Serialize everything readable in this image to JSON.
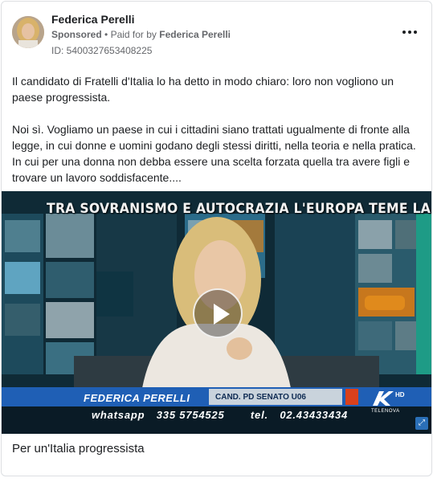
{
  "ad": {
    "page_name": "Federica Perelli",
    "sponsored_label": "Sponsored",
    "separator": "•",
    "paid_for_prefix": "Paid for by",
    "paid_for_name": "Federica Perelli",
    "ad_id": "ID: 5400327653408225",
    "more_icon": "more-horizontal-icon",
    "body_paragraphs": [
      "Il candidato di Fratelli d'Italia lo ha detto in modo chiaro: loro non vogliono un paese progressista.",
      "Noi sì. Vogliamo un paese in cui i cittadini siano trattati ugualmente di fronte alla legge, in cui donne e uomini godano degli stessi diritti, nella teoria e nella pratica. In cui per una donna non debba essere una scelta forzata quella tra avere figli e trovare un lavoro soddisfacente...."
    ],
    "caption": "Per un'Italia progressista"
  },
  "video": {
    "headline": "TRA SOVRANISMO E AUTOCRAZIA L'EUROPA TEME LA MELONI?",
    "lower_third_name": "FEDERICA PERELLI",
    "lower_third_candidacy": "CAND. PD SENATO U06",
    "whatsapp_label": "whatsapp",
    "whatsapp_number": "335 5754525",
    "tel_label": "tel.",
    "tel_number": "02.43433434",
    "channel_hd": "HD",
    "channel_name": "TELENOVA",
    "play_icon": "play-icon"
  },
  "colors": {
    "text_primary": "#1c1e21",
    "text_secondary": "#65676b",
    "card_border": "#dddfe2",
    "lower_third_blue": "#1f5fb5",
    "lower_third_red": "#d9401b"
  }
}
